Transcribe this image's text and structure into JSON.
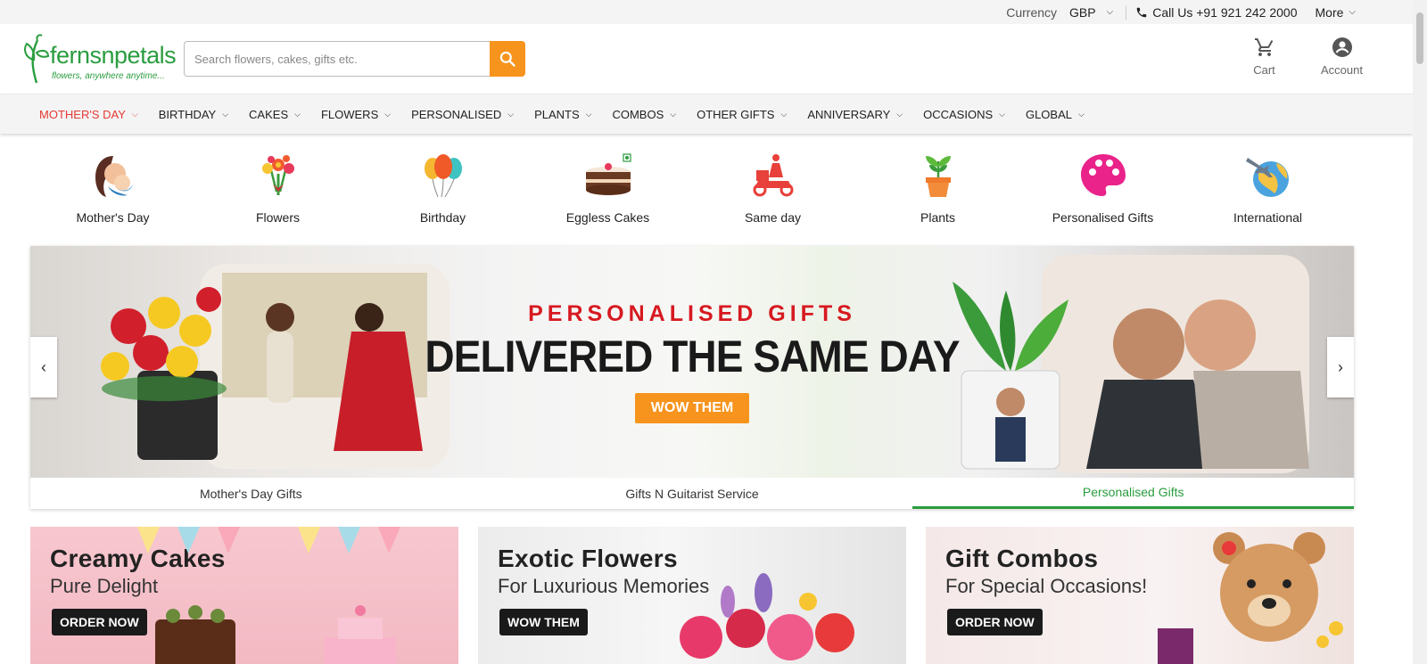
{
  "topbar": {
    "currency_label": "Currency",
    "currency_value": "GBP",
    "call_text": "Call Us +91 921 242 2000",
    "more_label": "More"
  },
  "logo": {
    "brand": "fernsnpetals",
    "tagline": "flowers, anywhere anytime..."
  },
  "search": {
    "placeholder": "Search flowers, cakes, gifts etc."
  },
  "header_actions": {
    "cart_label": "Cart",
    "account_label": "Account"
  },
  "nav": [
    {
      "label": "MOTHER'S DAY"
    },
    {
      "label": "BIRTHDAY"
    },
    {
      "label": "CAKES"
    },
    {
      "label": "FLOWERS"
    },
    {
      "label": "PERSONALISED"
    },
    {
      "label": "PLANTS"
    },
    {
      "label": "COMBOS"
    },
    {
      "label": "OTHER GIFTS"
    },
    {
      "label": "ANNIVERSARY"
    },
    {
      "label": "OCCASIONS"
    },
    {
      "label": "GLOBAL"
    }
  ],
  "categories": [
    {
      "label": "Mother's Day",
      "icon": "mother-child-icon"
    },
    {
      "label": "Flowers",
      "icon": "bouquet-icon"
    },
    {
      "label": "Birthday",
      "icon": "balloons-icon"
    },
    {
      "label": "Eggless Cakes",
      "icon": "cake-icon"
    },
    {
      "label": "Same day",
      "icon": "delivery-scooter-icon"
    },
    {
      "label": "Plants",
      "icon": "potted-plant-icon"
    },
    {
      "label": "Personalised Gifts",
      "icon": "palette-icon"
    },
    {
      "label": "International",
      "icon": "globe-plane-icon"
    }
  ],
  "carousel": {
    "subtitle": "PERSONALISED GIFTS",
    "title": "DELIVERED THE SAME DAY",
    "button": "WOW THEM",
    "tabs": [
      {
        "label": "Mother's Day Gifts"
      },
      {
        "label": "Gifts N Guitarist Service"
      },
      {
        "label": "Personalised Gifts"
      }
    ]
  },
  "tiles": [
    {
      "title": "Creamy Cakes",
      "subtitle": "Pure Delight",
      "button": "ORDER NOW"
    },
    {
      "title": "Exotic Flowers",
      "subtitle": "For Luxurious Memories",
      "button": "WOW THEM"
    },
    {
      "title": "Gift Combos",
      "subtitle": "For Special Occasions!",
      "button": "ORDER NOW"
    }
  ],
  "colors": {
    "accent_orange": "#f7941d",
    "brand_green": "#2a9d3f",
    "active_red": "#e53935"
  }
}
